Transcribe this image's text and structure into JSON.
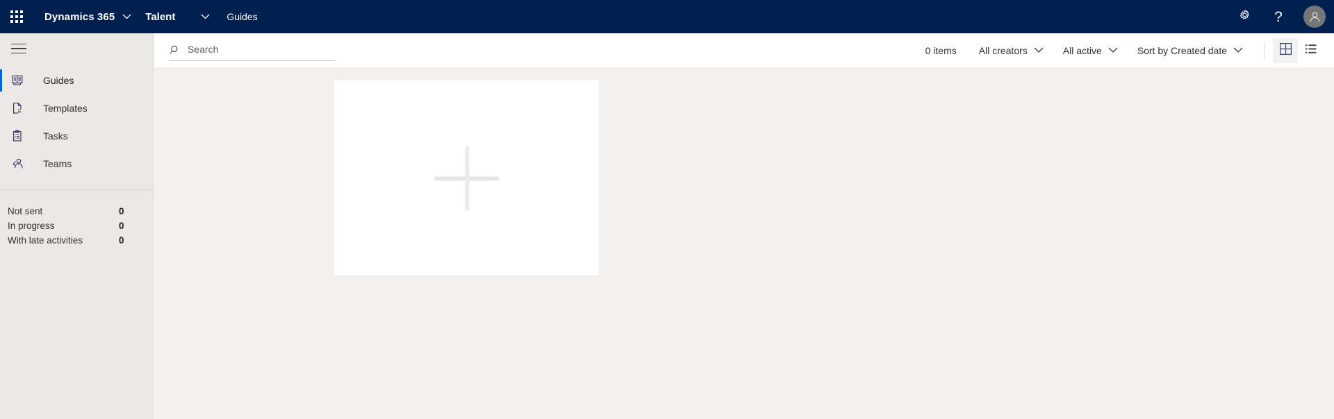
{
  "topbar": {
    "app_launcher_icon": "waffle-grid-icon",
    "brand": "Dynamics 365",
    "brand_chevron_icon": "chevron-down-icon",
    "module": "Talent",
    "module_chevron_icon": "chevron-down-icon",
    "breadcrumb": "Guides",
    "settings_icon": "gear-icon",
    "help_icon": "question-mark-icon",
    "help_glyph": "?",
    "avatar_icon": "person-avatar-icon",
    "background_color": "#002050"
  },
  "sidebar": {
    "hamburger_icon": "hamburger-menu-icon",
    "background_color": "#eae9e7",
    "accent_color": "#0b63ce",
    "items": [
      {
        "label": "Guides",
        "icon": "guides-book-icon",
        "selected": true
      },
      {
        "label": "Templates",
        "icon": "document-page-icon",
        "selected": false
      },
      {
        "label": "Tasks",
        "icon": "clipboard-task-icon",
        "selected": false
      },
      {
        "label": "Teams",
        "icon": "people-team-icon",
        "selected": false
      }
    ],
    "stats": [
      {
        "label": "Not sent",
        "value": "0"
      },
      {
        "label": "In progress",
        "value": "0"
      },
      {
        "label": "With late activities",
        "value": "0"
      }
    ]
  },
  "commandbar": {
    "search": {
      "icon": "search-magnifier-icon",
      "placeholder": "Search",
      "value": ""
    },
    "item_count": "0 items",
    "filters": [
      {
        "label": "All creators",
        "chevron_icon": "chevron-down-icon"
      },
      {
        "label": "All active",
        "chevron_icon": "chevron-down-icon"
      }
    ],
    "sort": {
      "label": "Sort by Created date",
      "chevron_icon": "chevron-down-icon"
    },
    "views": [
      {
        "name": "grid-view",
        "icon": "grid-view-icon",
        "active": true
      },
      {
        "name": "list-view",
        "icon": "list-view-icon",
        "active": false
      }
    ]
  },
  "content": {
    "background_color": "#f2f1ef",
    "new_card": {
      "icon": "plus-icon",
      "label": ""
    }
  }
}
